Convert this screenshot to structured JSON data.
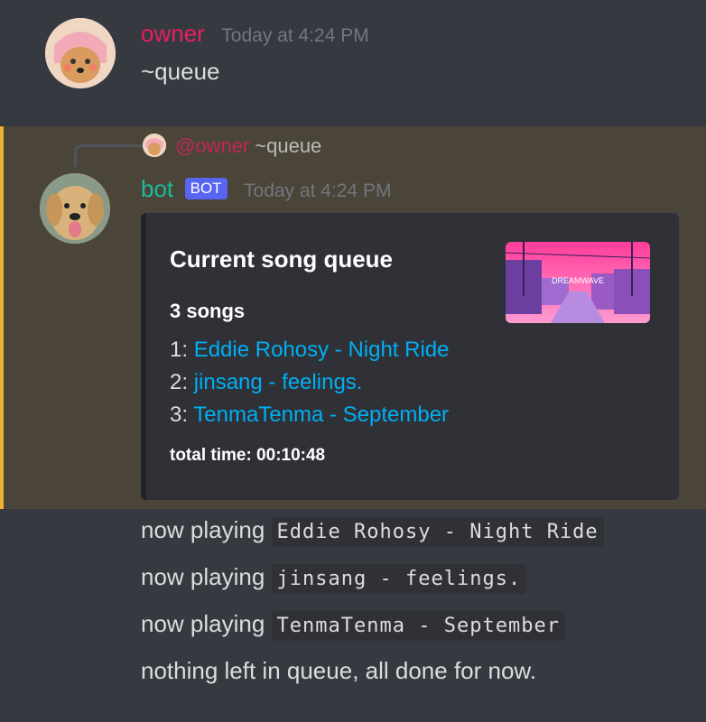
{
  "messages": {
    "first": {
      "username": "owner",
      "timestamp": "Today at 4:24 PM",
      "content": "~queue"
    },
    "reply": {
      "mention": "@owner",
      "text": "~queue"
    },
    "bot": {
      "username": "bot",
      "tag": "BOT",
      "timestamp": "Today at 4:24 PM"
    }
  },
  "embed": {
    "title": "Current song queue",
    "thumbnail_text": "DREAMWAVE",
    "count": "3 songs",
    "queue": [
      {
        "num": "1:",
        "title": "Eddie Rohosy - Night Ride"
      },
      {
        "num": "2:",
        "title": "jinsang - feelings."
      },
      {
        "num": "3:",
        "title": "TenmaTenma - September"
      }
    ],
    "total_time": "total time: 00:10:48"
  },
  "followups": [
    {
      "prefix": "now playing ",
      "code": "Eddie Rohosy - Night Ride"
    },
    {
      "prefix": "now playing ",
      "code": "jinsang - feelings."
    },
    {
      "prefix": "now playing ",
      "code": "TenmaTenma - September"
    },
    {
      "prefix": "nothing left in queue, all done for now.",
      "code": ""
    }
  ],
  "colors": {
    "background": "#36393f",
    "highlight": "#4a4538",
    "highlight_border": "#f0b132",
    "owner_name": "#e91e63",
    "bot_name": "#1abc9c",
    "bot_tag": "#5865f2",
    "link": "#00aff4",
    "embed_bg": "#2f3136"
  }
}
